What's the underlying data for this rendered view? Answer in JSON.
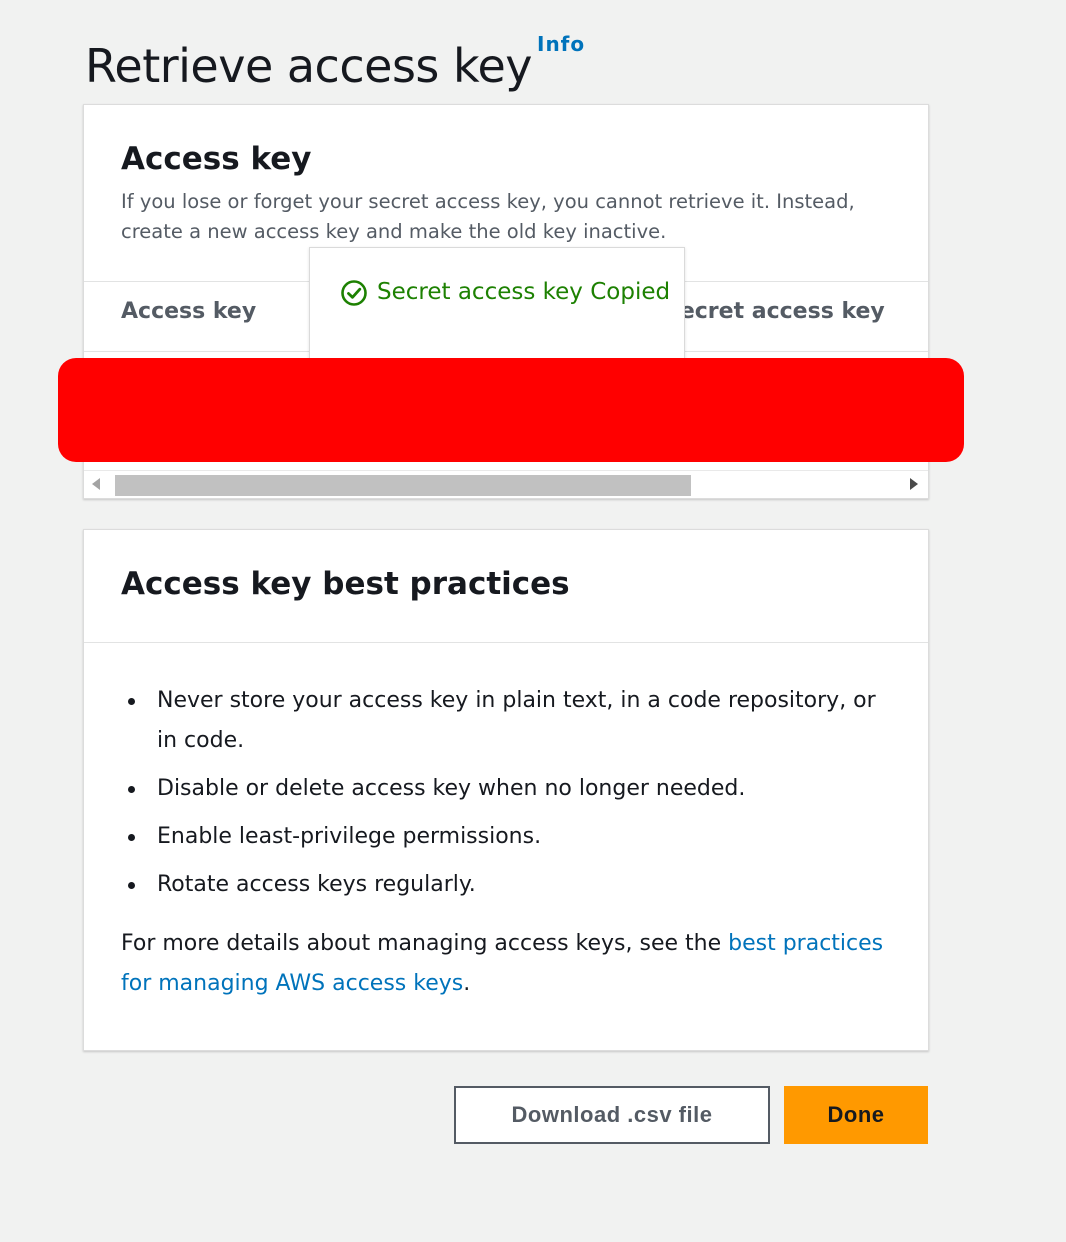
{
  "page": {
    "title": "Retrieve access key",
    "info_label": "Info"
  },
  "access_key_card": {
    "title": "Access key",
    "description": "If you lose or forget your secret access key, you cannot retrieve it. Instead, create a new access key and make the old key inactive.",
    "columns": [
      "Access key",
      "Secret access key"
    ]
  },
  "toast": {
    "icon": "check-circle-icon",
    "message": "Secret access key Copied",
    "color": "#1d8102"
  },
  "practices_card": {
    "title": "Access key best practices",
    "items": [
      "Never store your access key in plain text, in a code repository, or in code.",
      "Disable or delete access key when no longer needed.",
      "Enable least-privilege permissions.",
      "Rotate access keys regularly."
    ],
    "footer_prefix": "For more details about managing access keys, see the ",
    "footer_link": "best practices for managing AWS access keys",
    "footer_suffix": "."
  },
  "buttons": {
    "download_label": "Download .csv file",
    "done_label": "Done"
  },
  "colors": {
    "primary_button": "#ff9900",
    "link": "#0073bb",
    "redaction": "#ff0000"
  }
}
